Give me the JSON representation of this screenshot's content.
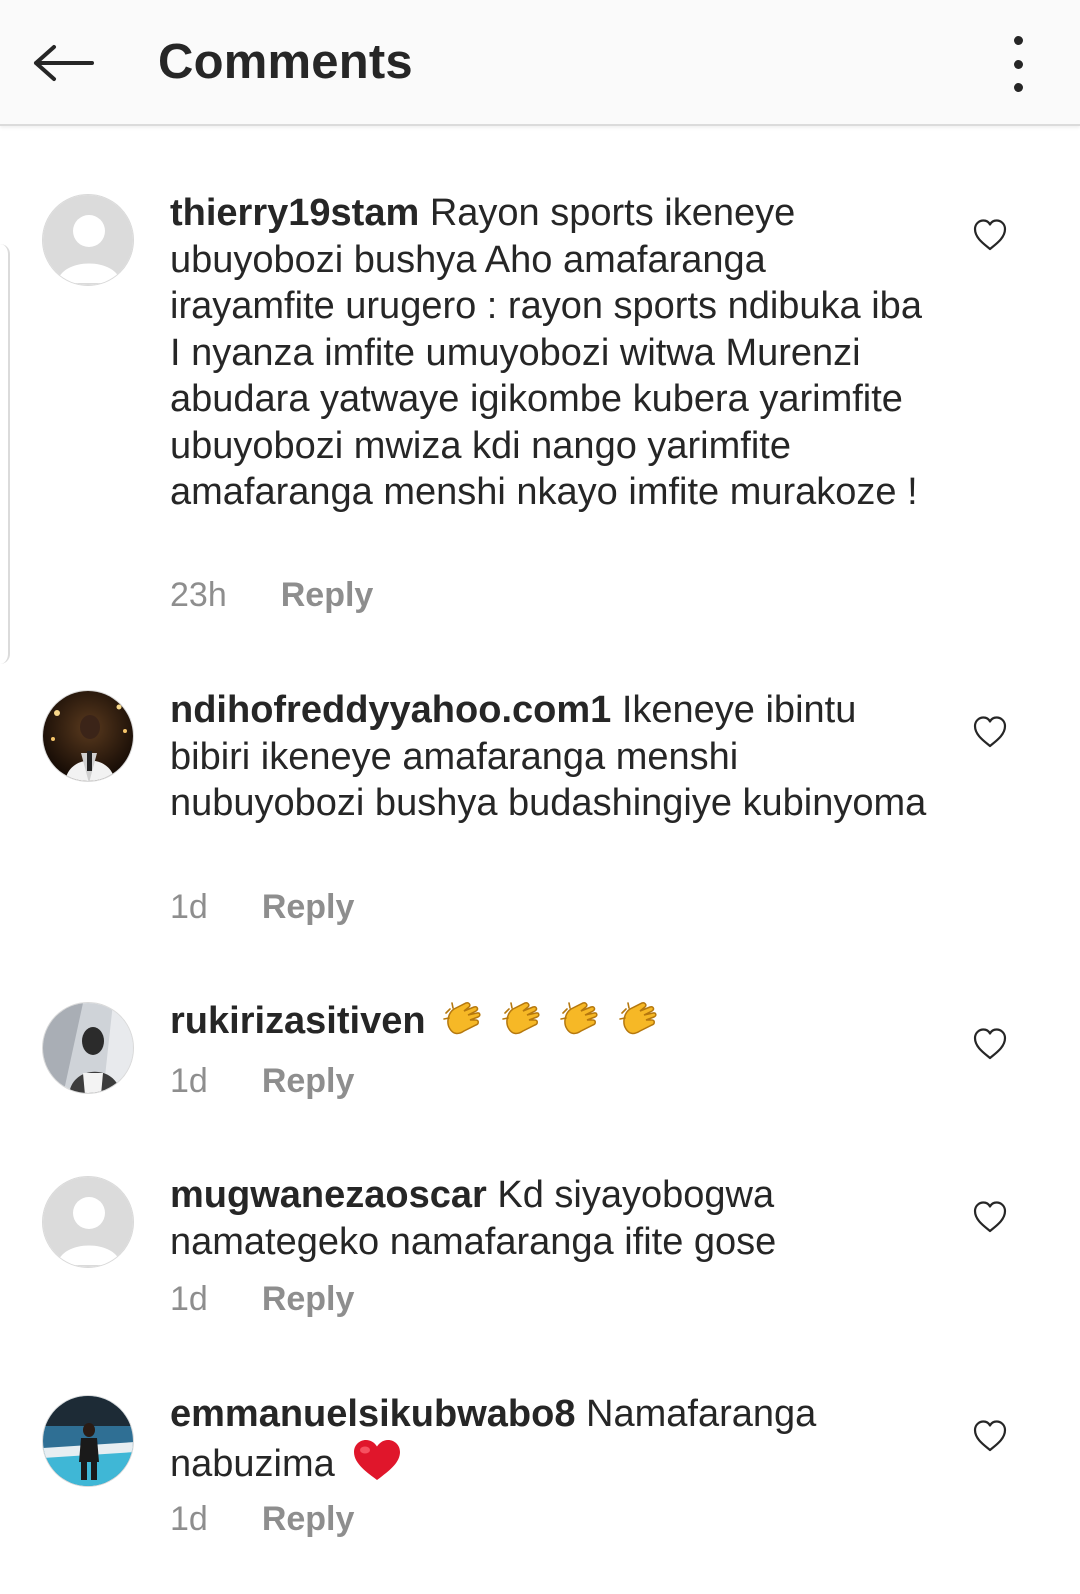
{
  "header": {
    "title": "Comments",
    "back_icon": "arrow-left-icon",
    "more_icon": "more-vertical-icon"
  },
  "comments": [
    {
      "username": "thierry19stam",
      "text": "Rayon sports ikeneye ubuyobozi bushya Aho amafaranga irayamfite urugero : rayon sports ndibuka iba I nyanza imfite umuyobozi witwa Murenzi abudara yatwaye igikombe kubera yarimfite ubuyobozi mwiza kdi nango yarimfite amafaranga menshi nkayo imfite murakoze !",
      "time": "23h",
      "reply": "Reply",
      "avatar": "default-avatar"
    },
    {
      "username": "ndihofreddyyahoo.com1",
      "text": "Ikeneye ibintu bibiri ikeneye amafaranga menshi nubuyobozi bushya budashingiye kubinyoma",
      "time": "1d",
      "reply": "Reply",
      "avatar": "photo-avatar"
    },
    {
      "username": "rukirizasitiven",
      "text": "",
      "emoji": "clapping-hands x4",
      "time": "1d",
      "reply": "Reply",
      "avatar": "photo-avatar"
    },
    {
      "username": "mugwanezaoscar",
      "text": "Kd siyayobogwa namategeko namafaranga ifite gose",
      "time": "1d",
      "reply": "Reply",
      "avatar": "default-avatar"
    },
    {
      "username": "emmanuelsikubwabo8",
      "text": "Namafaranga nabuzima",
      "emoji": "red-heart",
      "time": "1d",
      "reply": "Reply",
      "avatar": "photo-avatar"
    }
  ],
  "colors": {
    "text": "#262626",
    "meta": "#8e8e8e",
    "header_bg": "#fafafa",
    "divider": "#dbdbdb",
    "heart_emoji": "#e0162b"
  }
}
